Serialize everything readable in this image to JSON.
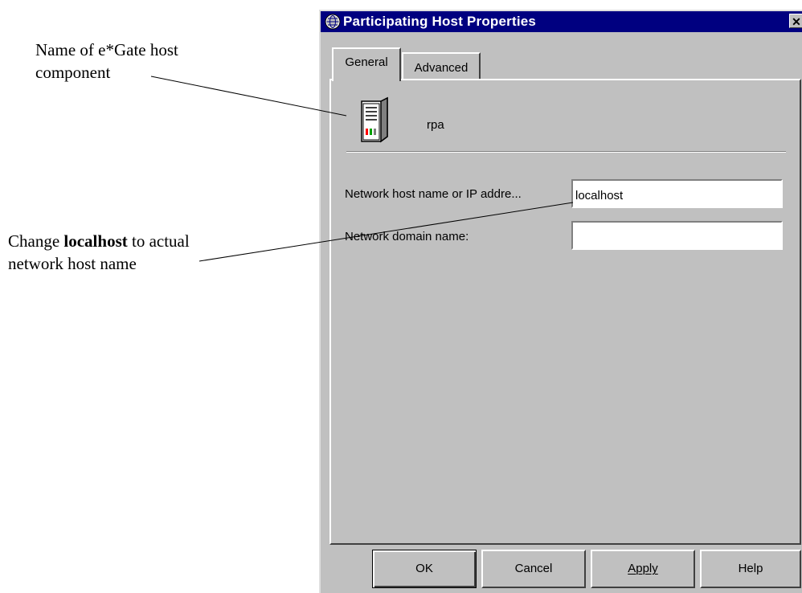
{
  "annotations": {
    "name_callout_line1": "Name of e*Gate host",
    "name_callout_line2": "component",
    "change_prefix": "Change ",
    "change_bold": "localhost",
    "change_suffix": " to actual",
    "change_line2": "network host name"
  },
  "dialog": {
    "title": "Participating Host Properties",
    "close_label": "✕",
    "title_icon": "globe-icon",
    "tabs": [
      {
        "label": "General",
        "active": true
      },
      {
        "label": "Advanced",
        "active": false
      }
    ],
    "host": {
      "icon": "server-tower-icon",
      "name": "rpa"
    },
    "fields": {
      "network_host_label": "Network host name or IP addre...",
      "network_host_value": "localhost",
      "network_domain_label": "Network domain name:",
      "network_domain_value": ""
    },
    "buttons": {
      "ok": "OK",
      "cancel": "Cancel",
      "apply": "Apply",
      "help": "Help"
    },
    "colors": {
      "titlebar": "#000080",
      "face": "#c0c0c0"
    }
  }
}
